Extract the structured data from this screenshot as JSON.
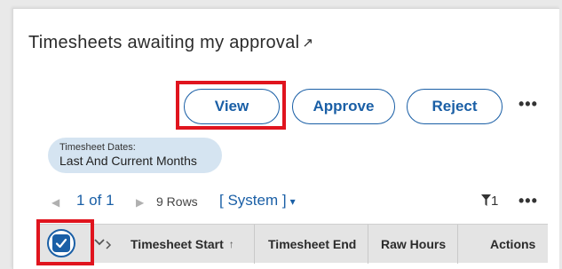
{
  "card": {
    "title": "Timesheets awaiting my approval",
    "title_link_icon": "↗"
  },
  "toolbar": {
    "view_label": "View",
    "approve_label": "Approve",
    "reject_label": "Reject",
    "more_icon": "•••"
  },
  "filter_chip": {
    "key": "Timesheet Dates:",
    "value": "Last And Current Months"
  },
  "pager": {
    "prev_icon": "◀",
    "pages": "1 of 1",
    "next_icon": "▶",
    "rows": "9 Rows",
    "view_selector": "[ System ]",
    "view_caret": "▾",
    "filter_count": "1",
    "more_icon": "•••"
  },
  "table": {
    "columns": [
      {
        "label": "Timesheet Start",
        "sort": "↑"
      },
      {
        "label": "Timesheet End"
      },
      {
        "label": "Raw Hours"
      },
      {
        "label": "Actions"
      }
    ]
  },
  "colors": {
    "accent": "#1a5fa6",
    "highlight": "#e0141e",
    "chip_bg": "#d5e4f1",
    "header_bg": "#e4e4e4"
  }
}
